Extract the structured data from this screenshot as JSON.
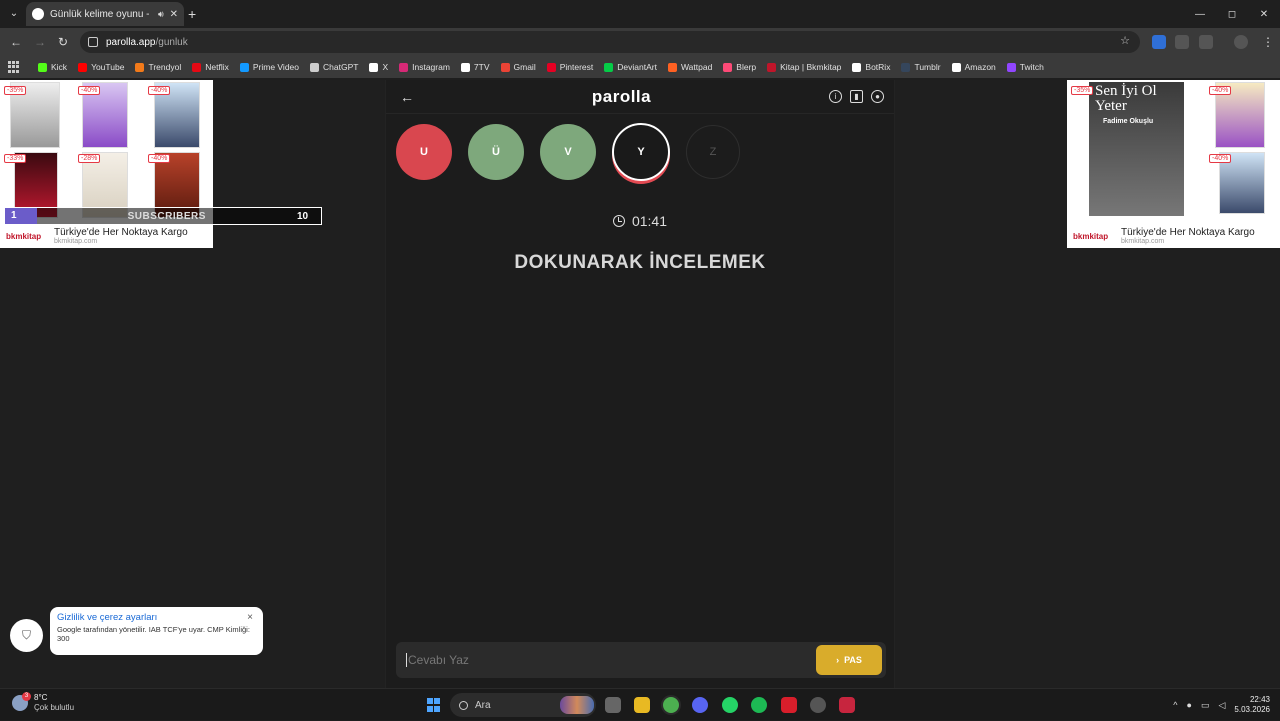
{
  "browser": {
    "tab_title": "Günlük kelime oyunu - paro",
    "new_tab": "+",
    "url_domain": "parolla.app",
    "url_path": "/gunluk",
    "window_controls": [
      "—",
      "◻",
      "✕"
    ],
    "bookmarks": [
      {
        "label": "Kick",
        "color": "#53fc18"
      },
      {
        "label": "YouTube",
        "color": "#ff0000"
      },
      {
        "label": "Trendyol",
        "color": "#f27a1a"
      },
      {
        "label": "Netflix",
        "color": "#e50914"
      },
      {
        "label": "Prime Video",
        "color": "#1399ff"
      },
      {
        "label": "ChatGPT",
        "color": "#cccccc"
      },
      {
        "label": "X",
        "color": "#ffffff"
      },
      {
        "label": "Instagram",
        "color": "#d62976"
      },
      {
        "label": "7TV",
        "color": "#ffffff"
      },
      {
        "label": "Gmail",
        "color": "#ea4335"
      },
      {
        "label": "Pinterest",
        "color": "#e60023"
      },
      {
        "label": "DeviantArt",
        "color": "#05cc47"
      },
      {
        "label": "Wattpad",
        "color": "#ff6122"
      },
      {
        "label": "Blerp",
        "color": "#fd4a77"
      },
      {
        "label": "Kitap | Bkmkitap",
        "color": "#c0152a"
      },
      {
        "label": "BotRix",
        "color": "#ffffff"
      },
      {
        "label": "Tumblr",
        "color": "#35465c"
      },
      {
        "label": "Amazon",
        "color": "#ffffff"
      },
      {
        "label": "Twitch",
        "color": "#9146ff"
      }
    ]
  },
  "ads": {
    "left": {
      "discounts": [
        "-35%",
        "-40%",
        "-40%",
        "-33%",
        "-28%",
        "-40%"
      ],
      "text": "Türkiye'de Her Noktaya Kargo",
      "sub": "bkmkitap.com",
      "logo": "bkmkitap"
    },
    "right": {
      "discounts": [
        "-35%",
        "-40%",
        "-40%"
      ],
      "book_title": "Sen İyi Ol Yeter",
      "book_author": "Fadime Okuşlu",
      "text": "Türkiye'de Her Noktaya Kargo",
      "sub": "bkmkitap.com",
      "logo": "bkmkitap"
    }
  },
  "overlay": {
    "subscribers_current": "1",
    "subscribers_label": "SUBSCRIBERS",
    "subscribers_goal": "10",
    "subscribers_progress": 0.1
  },
  "game": {
    "back": "←",
    "logo": "parolla",
    "letters": [
      {
        "char": "U",
        "state": "wrong"
      },
      {
        "char": "Ü",
        "state": "right"
      },
      {
        "char": "V",
        "state": "right"
      },
      {
        "char": "Y",
        "state": "current"
      },
      {
        "char": "Z",
        "state": "pending"
      }
    ],
    "timer": "01:41",
    "question": "DOKUNARAK İNCELEMEK",
    "answer_placeholder": "Cevabı Yaz",
    "pass_label": "PAS"
  },
  "consent": {
    "title": "Gizlilik ve çerez ayarları",
    "body": "Google tarafından yönetilir. IAB TCF'ye uyar. CMP Kimliği: 300",
    "close": "×"
  },
  "taskbar": {
    "weather_badge": "3",
    "temperature": "8°C",
    "weather_desc": "Çok bulutlu",
    "search_label": "Ara",
    "time": "22:43",
    "date": "5.03.2026"
  }
}
